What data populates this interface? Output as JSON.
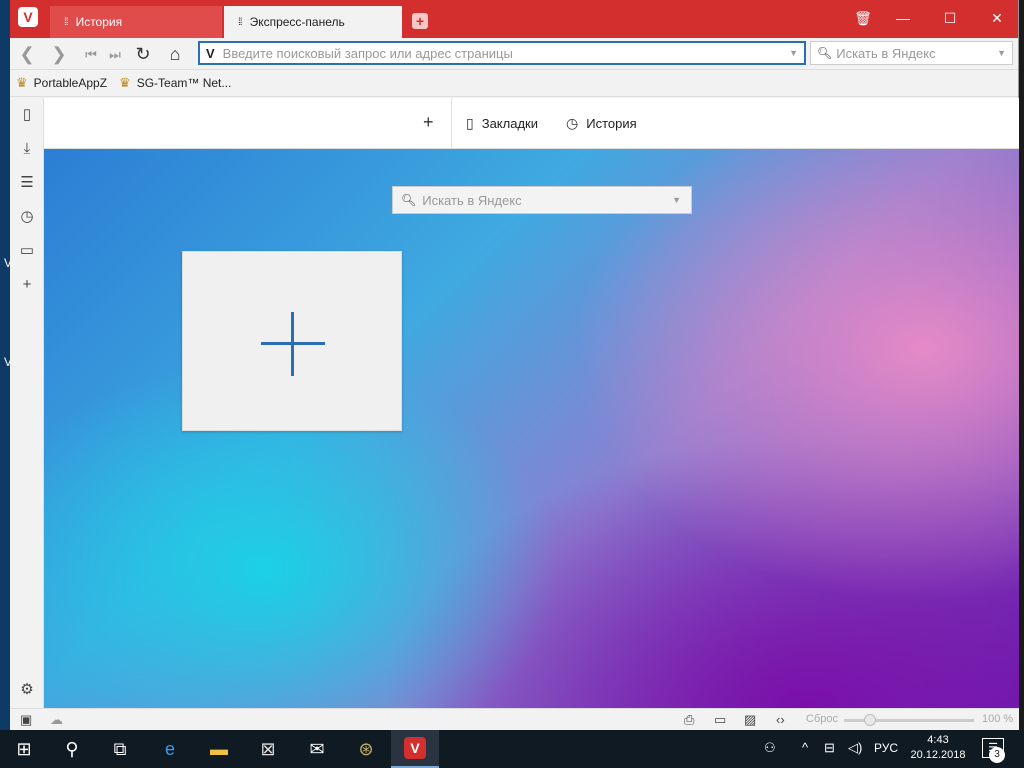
{
  "desktop": {
    "fragments": [
      "V",
      "V"
    ]
  },
  "tabs": [
    {
      "label": "История"
    },
    {
      "label": "Экспресс-панель"
    }
  ],
  "addressbar": {
    "url_placeholder": "Введите поисковый запрос или адрес страницы",
    "search_placeholder": "Искать в Яндекс"
  },
  "bookmarks": [
    {
      "label": "PortableAppZ"
    },
    {
      "label": "SG-Team™ Net..."
    }
  ],
  "speeddial_header": {
    "bookmarks_label": "Закладки",
    "history_label": "История"
  },
  "content": {
    "search_placeholder": "Искать в Яндекс"
  },
  "statusbar": {
    "zoom_reset_label": "Сброс",
    "zoom_value": "100 %"
  },
  "taskbar": {
    "language": "РУС",
    "time": "4:43",
    "date": "20.12.2018",
    "notification_count": "3"
  },
  "colors": {
    "accent_red": "#d32f2f",
    "accent_blue": "#2a6fb5"
  }
}
